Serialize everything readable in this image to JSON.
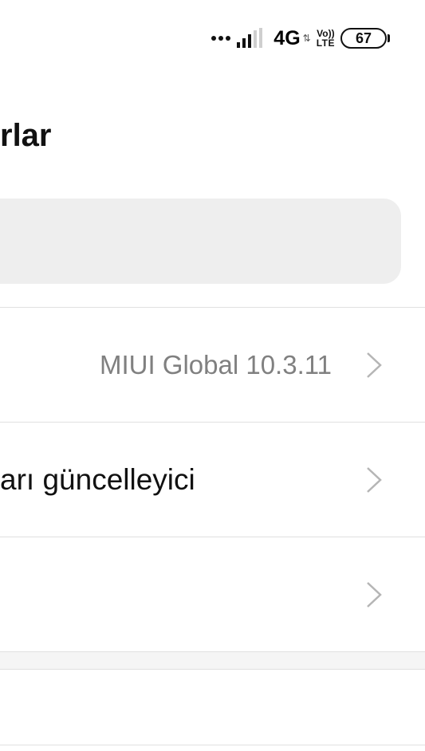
{
  "status_bar": {
    "network_type": "4G",
    "volte_top": "Vo))",
    "volte_bottom": "LTE",
    "battery_level": "67",
    "signal_icon": "signal-icon",
    "more_icon": "more-dots-icon"
  },
  "header": {
    "title": "rlar"
  },
  "search": {
    "placeholder": ""
  },
  "rows": [
    {
      "label": "",
      "value": "MIUI Global 10.3.11",
      "chevron_icon": "chevron-right-icon"
    },
    {
      "label": "arı güncelleyici",
      "value": "",
      "chevron_icon": "chevron-right-icon"
    },
    {
      "label": "",
      "value": "",
      "chevron_icon": "chevron-right-icon"
    }
  ],
  "colors": {
    "background": "#ffffff",
    "search_bg": "#eeeeee",
    "divider": "#e0e0e0",
    "secondary_text": "#808080",
    "chevron": "#b5b5b5"
  }
}
